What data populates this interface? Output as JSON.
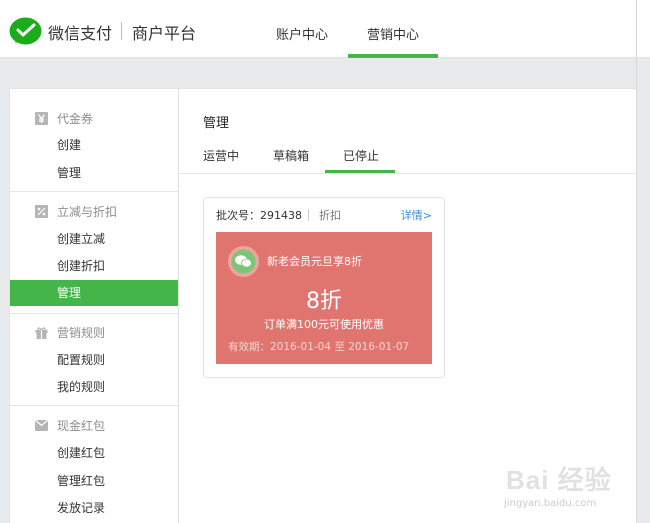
{
  "header": {
    "brand": "微信支付",
    "brand_sub": "商户平台",
    "nav": [
      {
        "label": "账户中心",
        "active": false
      },
      {
        "label": "营销中心",
        "active": true
      }
    ],
    "accent_color": "#44b549"
  },
  "sidebar": {
    "groups": [
      {
        "title": "代金券",
        "icon": "yen-icon",
        "items": [
          "创建",
          "管理"
        ]
      },
      {
        "title": "立减与折扣",
        "icon": "discount-icon",
        "items": [
          "创建立减",
          "创建折扣",
          "管理"
        ],
        "active_item": "管理"
      },
      {
        "title": "营销规则",
        "icon": "gift-icon",
        "items": [
          "配置规则",
          "我的规则"
        ]
      },
      {
        "title": "现金红包",
        "icon": "envelope-icon",
        "items": [
          "创建红包",
          "管理红包",
          "发放记录"
        ]
      }
    ]
  },
  "main": {
    "title": "管理",
    "tabs": [
      {
        "label": "运营中",
        "active": false
      },
      {
        "label": "草稿箱",
        "active": false
      },
      {
        "label": "已停止",
        "active": true
      }
    ],
    "card": {
      "batch_label": "批次号：291438",
      "type": "折扣",
      "detail_link": "详情>",
      "coupon": {
        "name": "新老会员元旦享8折",
        "value": "8折",
        "condition": "订单满100元可使用优惠",
        "validity": "有效期：2016-01-04 至 2016-01-07",
        "background_color": "#e0756f"
      }
    }
  },
  "watermark": {
    "text": "Bai 经验",
    "sub": "jingyan.baidu.com"
  }
}
